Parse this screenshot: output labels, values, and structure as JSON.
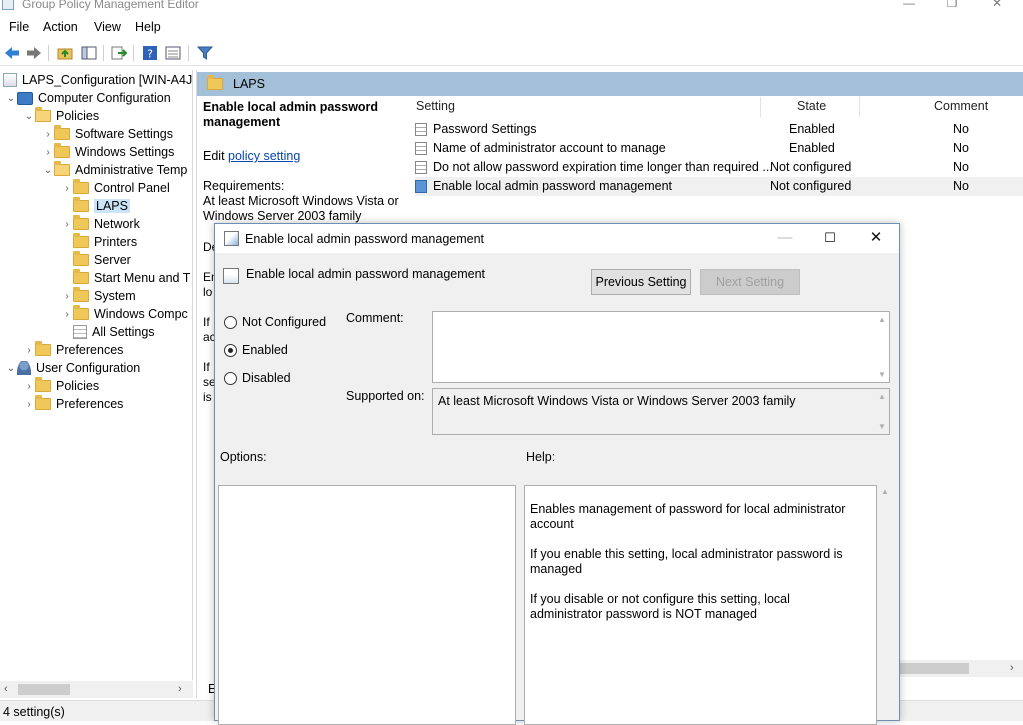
{
  "window": {
    "title": "Group Policy Management Editor"
  },
  "menu": {
    "file": "File",
    "action": "Action",
    "view": "View",
    "help": "Help"
  },
  "tree": {
    "root": "LAPS_Configuration [WIN-A4JR",
    "computer_config": "Computer Configuration",
    "policies": "Policies",
    "software_settings": "Software Settings",
    "windows_settings": "Windows Settings",
    "admin_templates": "Administrative Temp",
    "control_panel": "Control Panel",
    "laps": "LAPS",
    "network": "Network",
    "printers": "Printers",
    "server": "Server",
    "start_menu": "Start Menu and T",
    "system": "System",
    "windows_components": "Windows Compc",
    "all_settings": "All Settings",
    "preferences": "Preferences",
    "user_config": "User Configuration",
    "user_policies": "Policies",
    "user_preferences": "Preferences"
  },
  "right": {
    "header": "LAPS",
    "desc_title": "Enable local admin password management",
    "edit_prefix": "Edit",
    "edit_link": "policy setting",
    "requirements_label": "Requirements:",
    "requirements_text": "At least Microsoft Windows Vista or Windows Server 2003 family",
    "partial_lines": [
      "De",
      "En",
      "lo",
      "If",
      "ac",
      "If",
      "se",
      "is"
    ],
    "tab_stub": "E",
    "columns": {
      "setting": "Setting",
      "state": "State",
      "comment": "Comment"
    },
    "rows": [
      {
        "name": "Password Settings",
        "state": "Enabled",
        "comment": "No"
      },
      {
        "name": "Name of administrator account to manage",
        "state": "Enabled",
        "comment": "No"
      },
      {
        "name": "Do not allow password expiration time longer than required ...",
        "state": "Not configured",
        "comment": "No"
      },
      {
        "name": "Enable local admin password management",
        "state": "Not configured",
        "comment": "No"
      }
    ]
  },
  "status": {
    "text": "4 setting(s)"
  },
  "dialog": {
    "title": "Enable local admin password management",
    "subtitle": "Enable local admin password management",
    "prev_button": "Previous Setting",
    "next_button": "Next Setting",
    "radios": {
      "not_configured": "Not Configured",
      "enabled": "Enabled",
      "disabled": "Disabled"
    },
    "selected": "enabled",
    "comment_label": "Comment:",
    "comment_value": "",
    "supported_label": "Supported on:",
    "supported_value": "At least Microsoft Windows Vista or Windows Server 2003 family",
    "options_label": "Options:",
    "help_label": "Help:",
    "help": [
      "Enables management of password for local administrator account",
      "If you enable this setting, local administrator password is managed",
      "If you disable or not configure this setting, local administrator password is NOT managed"
    ]
  }
}
